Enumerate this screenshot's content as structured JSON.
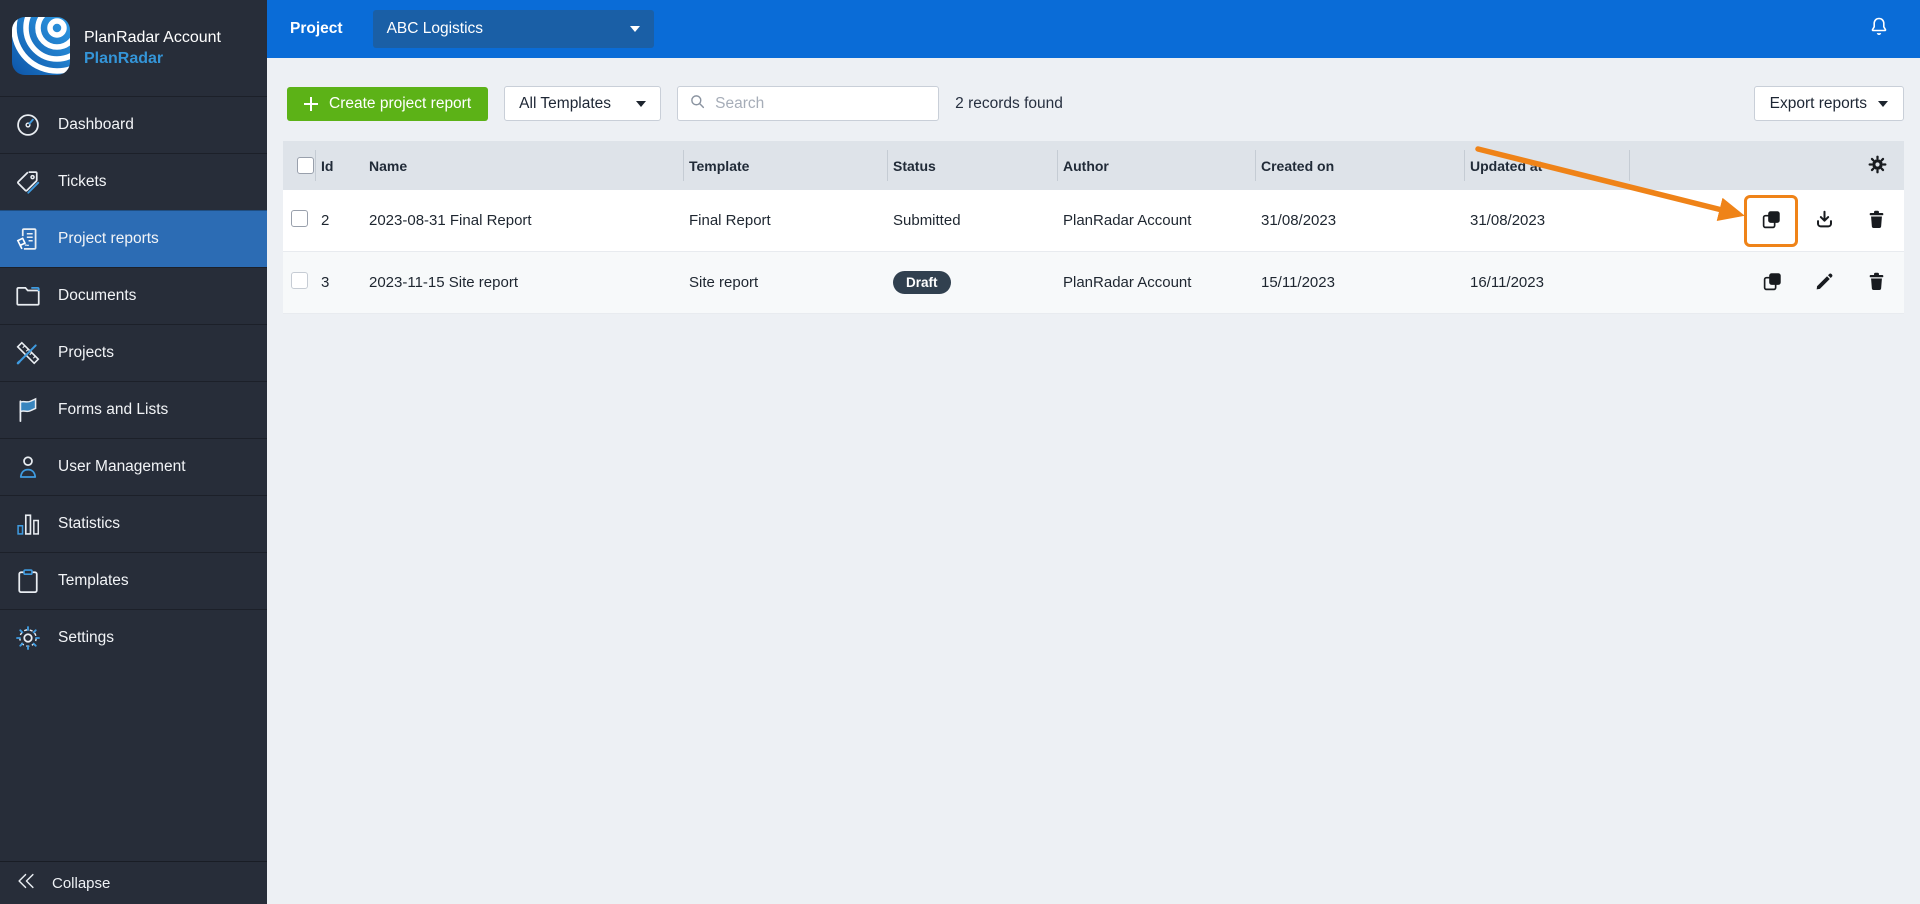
{
  "sidebar": {
    "account_name": "PlanRadar Account",
    "brand_name": "PlanRadar",
    "items": [
      {
        "label": "Dashboard",
        "icon": "gauge-icon",
        "active": false
      },
      {
        "label": "Tickets",
        "icon": "tag-icon",
        "active": false
      },
      {
        "label": "Project reports",
        "icon": "report-stamp-icon",
        "active": true
      },
      {
        "label": "Documents",
        "icon": "folder-icon",
        "active": false
      },
      {
        "label": "Projects",
        "icon": "ruler-pencil-icon",
        "active": false
      },
      {
        "label": "Forms and Lists",
        "icon": "flag-icon",
        "active": false
      },
      {
        "label": "User Management",
        "icon": "user-icon",
        "active": false
      },
      {
        "label": "Statistics",
        "icon": "bar-chart-icon",
        "active": false
      },
      {
        "label": "Templates",
        "icon": "clipboard-icon",
        "active": false
      },
      {
        "label": "Settings",
        "icon": "gear-icon",
        "active": false
      }
    ],
    "collapse_label": "Collapse"
  },
  "topbar": {
    "project_label": "Project",
    "project_selector_value": "ABC Logistics",
    "notification_icon": "bell-icon"
  },
  "toolbar": {
    "create_button_label": "Create project report",
    "template_filter_value": "All Templates",
    "search_placeholder": "Search",
    "records_found": "2 records found",
    "export_button_label": "Export reports"
  },
  "table": {
    "columns": [
      "Id",
      "Name",
      "Template",
      "Status",
      "Author",
      "Created on",
      "Updated at"
    ],
    "rows": [
      {
        "id": "2",
        "name": "2023-08-31 Final Report",
        "template": "Final Report",
        "status": "Submitted",
        "status_style": "text",
        "author": "PlanRadar Account",
        "created_on": "31/08/2023",
        "updated_at": "31/08/2023",
        "actions": [
          "copy",
          "download",
          "delete"
        ],
        "highlighted_action": "copy"
      },
      {
        "id": "3",
        "name": "2023-11-15 Site report",
        "template": "Site report",
        "status": "Draft",
        "status_style": "badge",
        "author": "PlanRadar Account",
        "created_on": "15/11/2023",
        "updated_at": "16/11/2023",
        "actions": [
          "copy",
          "edit",
          "delete"
        ],
        "highlighted_action": null
      }
    ],
    "settings_icon": "gear-icon"
  },
  "annotation": {
    "type": "arrow-and-box-highlight",
    "points_to": "copy action of row id 2",
    "color": "#ef8318"
  },
  "colors": {
    "topbar_blue": "#0a6cd7",
    "topbar_select_blue": "#1a5fa6",
    "sidebar_dark": "#272d39",
    "sidebar_active_blue": "#2c6cb4",
    "brand_blue": "#3495d8",
    "create_green": "#5cb217",
    "table_header_gray": "#dee3e9",
    "badge_slate": "#31404f",
    "annotation_orange": "#ef8318",
    "content_background": "#edf0f4"
  }
}
